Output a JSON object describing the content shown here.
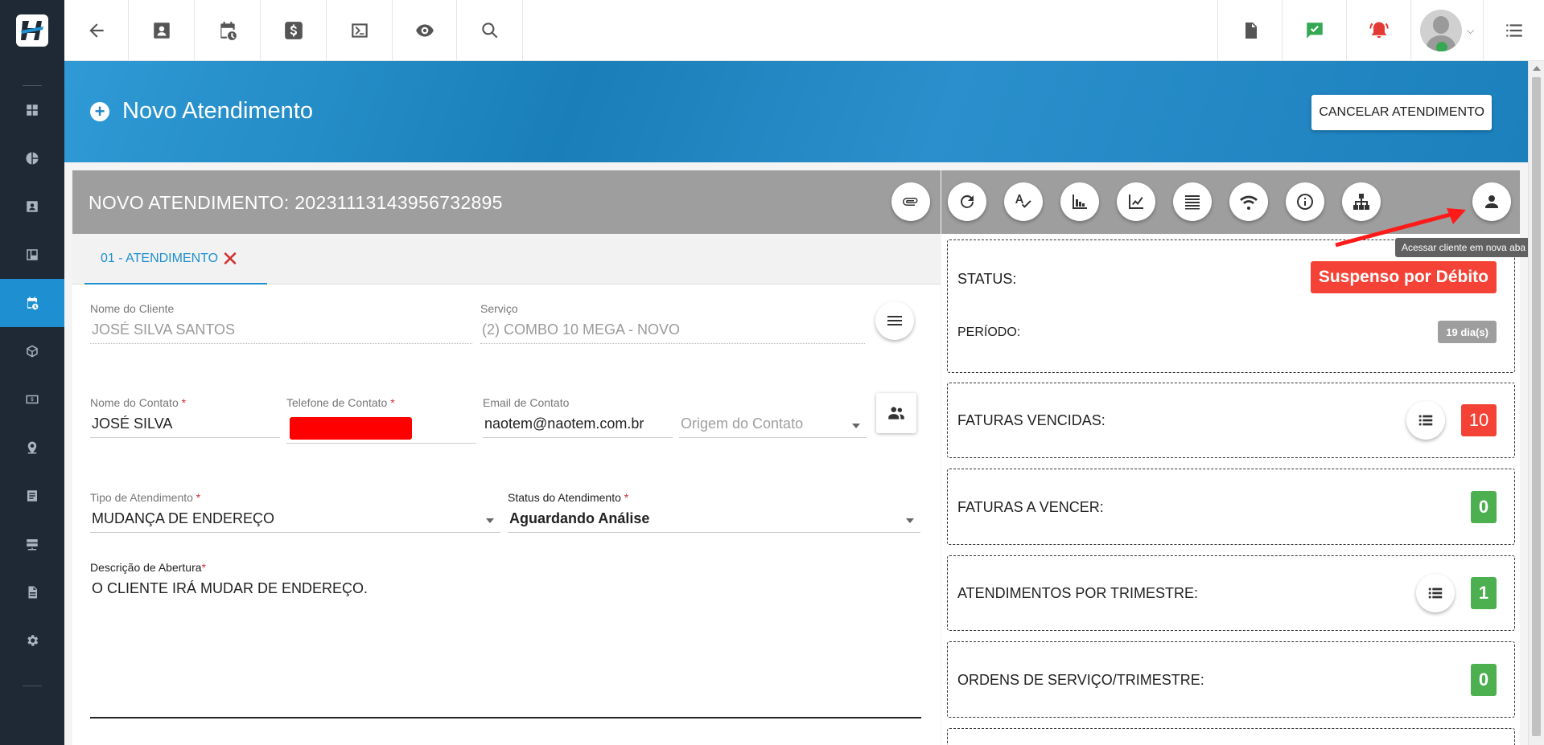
{
  "sidebar": {
    "items": [
      {
        "icon": "dashboard-icon"
      },
      {
        "icon": "pie-chart-icon"
      },
      {
        "icon": "contact-card-icon"
      },
      {
        "icon": "board-icon"
      },
      {
        "icon": "calendar-clock-icon",
        "active": true
      },
      {
        "icon": "box-icon"
      },
      {
        "icon": "money-icon"
      },
      {
        "icon": "map-pin-icon"
      },
      {
        "icon": "list-doc-icon"
      },
      {
        "icon": "server-icon"
      },
      {
        "icon": "document-icon"
      },
      {
        "icon": "gear-icon"
      }
    ]
  },
  "topbar": {
    "buttons": [
      "back-icon",
      "contact-card-icon",
      "calendar-clock-icon",
      "dollar-icon",
      "terminal-icon",
      "eye-icon",
      "search-icon"
    ],
    "right": [
      "pdf-icon",
      "chat-check-icon",
      "alarm-icon",
      "user-avatar",
      "menu-list-icon"
    ]
  },
  "header": {
    "title": "Novo Atendimento",
    "cancel_label": "CANCELAR ATENDIMENTO"
  },
  "form": {
    "title": "NOVO ATENDIMENTO: 20231113143956732895",
    "tab_label": "01 - ATENDIMENTO",
    "tab_close": "✕",
    "cliente": {
      "label": "Nome do Cliente",
      "value": "JOSÉ SILVA SANTOS"
    },
    "servico": {
      "label": "Serviço",
      "value": "(2) COMBO 10 MEGA - NOVO"
    },
    "contato": {
      "label": "Nome do Contato",
      "value": "JOSÉ SILVA"
    },
    "telefone": {
      "label": "Telefone de Contato"
    },
    "email": {
      "label": "Email de Contato",
      "value": "naotem@naotem.com.br"
    },
    "origem": {
      "placeholder": "Origem do Contato"
    },
    "tipo": {
      "label": "Tipo de Atendimento",
      "value": "MUDANÇA DE ENDEREÇO"
    },
    "status": {
      "label": "Status do Atendimento",
      "value": "Aguardando Análise"
    },
    "descricao": {
      "label": "Descrição de Abertura",
      "value": "O CLIENTE IRÁ MUDAR DE ENDEREÇO."
    },
    "required_mark": "*"
  },
  "panel": {
    "toolbar": [
      "refresh-icon",
      "spellcheck-icon",
      "bar-chart-icon",
      "line-chart-icon",
      "lines-icon",
      "wifi-icon",
      "info-icon",
      "sitemap-icon",
      "person-icon"
    ],
    "tooltip": "Acessar cliente em nova aba",
    "status_label": "STATUS:",
    "status_value": "Suspenso por Débito",
    "periodo_label": "PERÍODO:",
    "periodo_value": "19 dia(s)",
    "faturas_vencidas_label": "FATURAS VENCIDAS:",
    "faturas_vencidas_value": "10",
    "faturas_vencer_label": "FATURAS A VENCER:",
    "faturas_vencer_value": "0",
    "atendimentos_label": "ATENDIMENTOS POR TRIMESTRE:",
    "atendimentos_value": "1",
    "ordens_label": "ORDENS DE SERVIÇO/TRIMESTRE:",
    "ordens_value": "0"
  },
  "colors": {
    "accent": "#1e8fd0",
    "danger": "#f44336",
    "success": "#4caf50",
    "sidebar": "#1f2935"
  }
}
